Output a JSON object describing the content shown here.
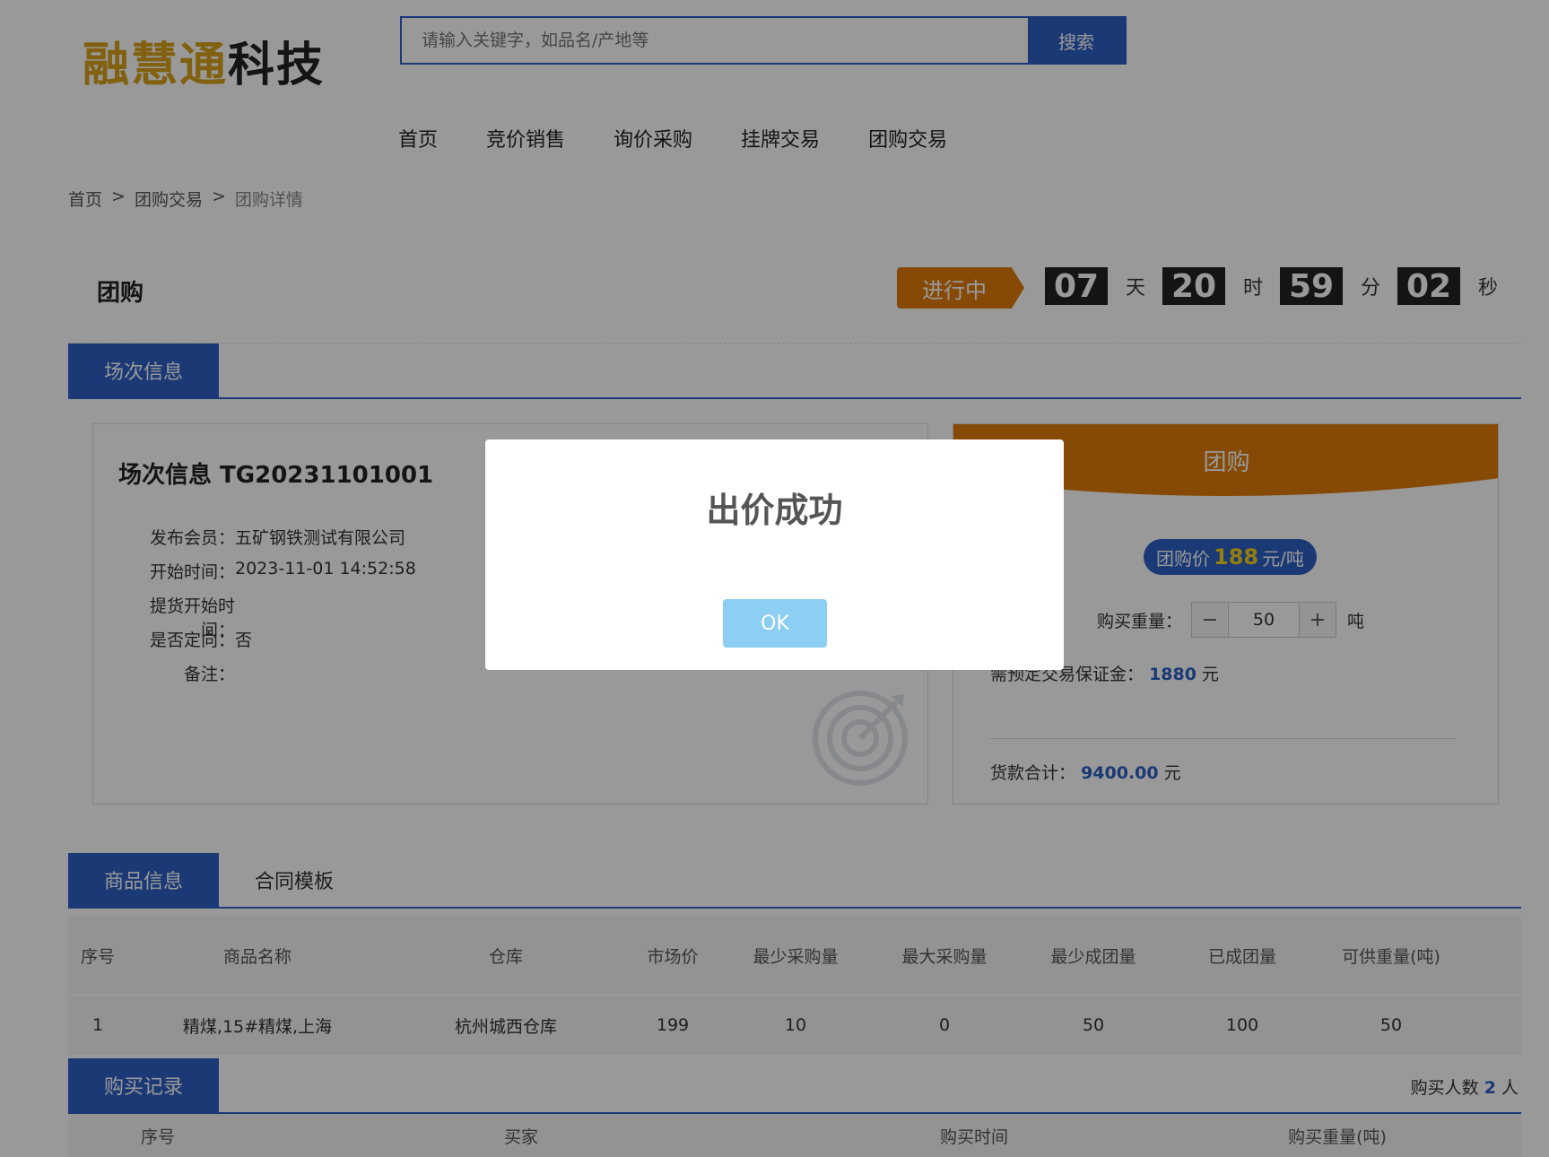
{
  "header": {
    "logo_part1": "融慧通",
    "logo_part2": "科技",
    "search_placeholder": "请输入关键字，如品名/产地等",
    "search_button": "搜索"
  },
  "nav": [
    "首页",
    "竞价销售",
    "询价采购",
    "挂牌交易",
    "团购交易"
  ],
  "breadcrumb": [
    "首页",
    "团购交易",
    "团购详情"
  ],
  "breadcrumb_sep": ">",
  "title": "团购",
  "status": "进行中",
  "countdown": [
    {
      "value": "07",
      "unit": "天"
    },
    {
      "value": "20",
      "unit": "时"
    },
    {
      "value": "59",
      "unit": "分"
    },
    {
      "value": "02",
      "unit": "秒"
    }
  ],
  "session_tab": "场次信息",
  "session": {
    "heading": "场次信息 TG20231101001",
    "fields": [
      {
        "label": "发布会员：",
        "value": "五矿钢铁测试有限公司"
      },
      {
        "label": "开始时间：",
        "value": "2023-11-01 14:52:58"
      },
      {
        "label": "提货开始时间：",
        "value": ""
      },
      {
        "label": "是否定向：",
        "value": "否"
      },
      {
        "label": "备注：",
        "value": ""
      }
    ]
  },
  "buy": {
    "header": "团购",
    "price_label": "团购价",
    "price_value": "188",
    "price_unit": "元/吨",
    "qty_label": "购买重量：",
    "qty_minus": "−",
    "qty_value": "50",
    "qty_plus": "+",
    "qty_unit": "吨",
    "deposit_label": "需预定交易保证金：",
    "deposit_value": "1880",
    "deposit_unit": "元",
    "total_label": "货款合计：",
    "total_value": "9400.00",
    "total_unit": "元"
  },
  "goods_tabs": [
    "商品信息",
    "合同模板"
  ],
  "goods_table": {
    "headers": [
      "序号",
      "商品名称",
      "仓库",
      "市场价",
      "最少采购量",
      "最大采购量",
      "最少成团量",
      "已成团量",
      "可供重量(吨)"
    ],
    "rows": [
      [
        "1",
        "精煤,15#精煤,上海",
        "杭州城西仓库",
        "199",
        "10",
        "0",
        "50",
        "100",
        "50"
      ]
    ]
  },
  "record_tab": "购买记录",
  "record_count_label": "购买人数",
  "record_count_value": "2",
  "record_count_unit": "人",
  "record_headers": [
    "序号",
    "买家",
    "购买时间",
    "购买重量(吨)"
  ],
  "modal": {
    "title": "出价成功",
    "ok": "OK"
  },
  "colors": {
    "primary": "#2d5fc4",
    "orange": "#e07c0a",
    "gold": "#d8a11a",
    "ok_button": "#8ccff3"
  }
}
